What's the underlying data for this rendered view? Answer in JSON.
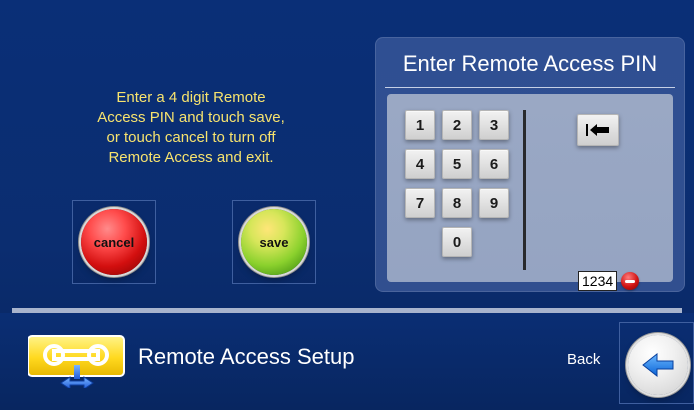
{
  "instructions": {
    "line1": "Enter a 4 digit Remote",
    "line2": "Access PIN and touch save,",
    "line3": "or touch cancel to turn off",
    "line4": "Remote Access and exit."
  },
  "actions": {
    "cancel_label": "cancel",
    "save_label": "save"
  },
  "pin_panel": {
    "title": "Enter Remote Access PIN",
    "keys": [
      "1",
      "2",
      "3",
      "4",
      "5",
      "6",
      "7",
      "8",
      "9",
      "0"
    ],
    "backspace_icon": "backspace-icon",
    "current_value": "1234",
    "clear_icon": "clear-icon"
  },
  "footer": {
    "title": "Remote Access Setup",
    "back_label": "Back",
    "icon": "remote-access-icon",
    "back_icon": "back-arrow-icon"
  },
  "colors": {
    "background": "#0b2d70",
    "instruction_text": "#f7e36e",
    "panel": "#2f4f92",
    "panel_inner": "#9aa8c4"
  }
}
